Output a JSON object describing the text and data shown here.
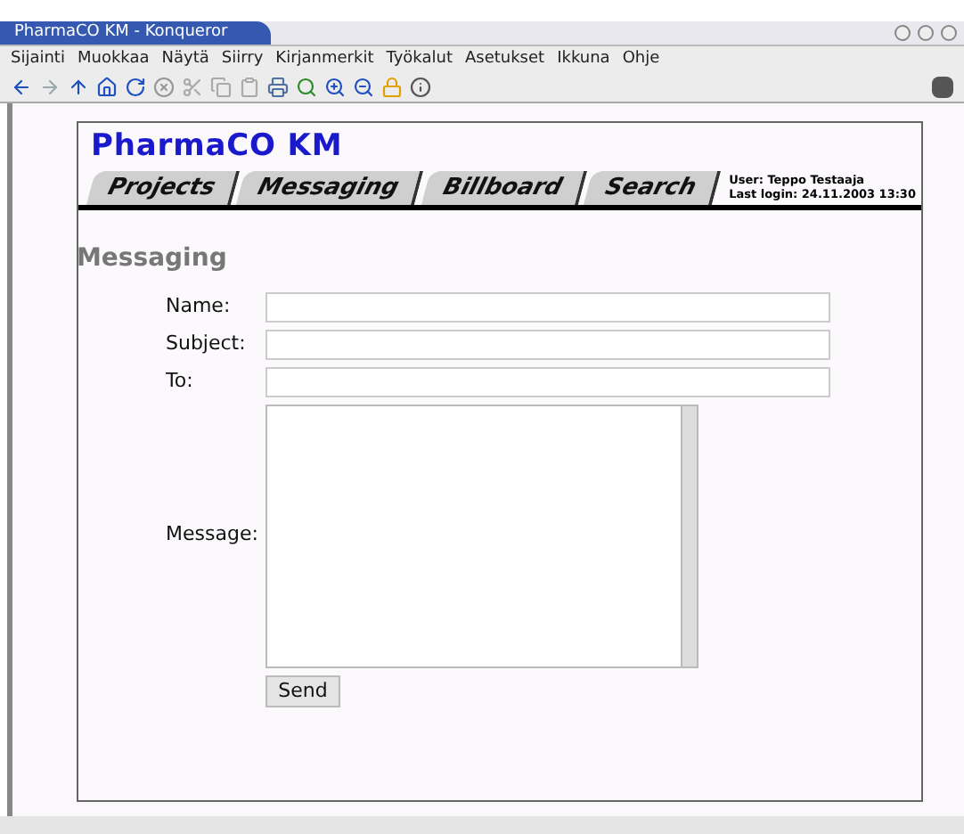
{
  "window": {
    "title": "PharmaCO KM - Konqueror"
  },
  "menu": [
    {
      "label": "Sijainti"
    },
    {
      "label": "Muokkaa"
    },
    {
      "label": "Näytä"
    },
    {
      "label": "Siirry"
    },
    {
      "label": "Kirjanmerkit"
    },
    {
      "label": "Työkalut"
    },
    {
      "label": "Asetukset"
    },
    {
      "label": "Ikkuna"
    },
    {
      "label": "Ohje"
    }
  ],
  "page": {
    "logo": "PharmaCO KM",
    "tabs": [
      {
        "label": "Projects"
      },
      {
        "label": "Messaging"
      },
      {
        "label": "Billboard"
      },
      {
        "label": "Search"
      }
    ],
    "user": "User: Teppo Testaaja",
    "last_login": "Last login: 24.11.2003 13:30",
    "heading": "Messaging",
    "fields": [
      {
        "kind": "line",
        "label": "Name:"
      },
      {
        "kind": "line",
        "label": "Subject:"
      },
      {
        "kind": "line",
        "label": "To:"
      },
      {
        "kind": "area",
        "label": "Message:"
      }
    ],
    "button": "Send"
  }
}
